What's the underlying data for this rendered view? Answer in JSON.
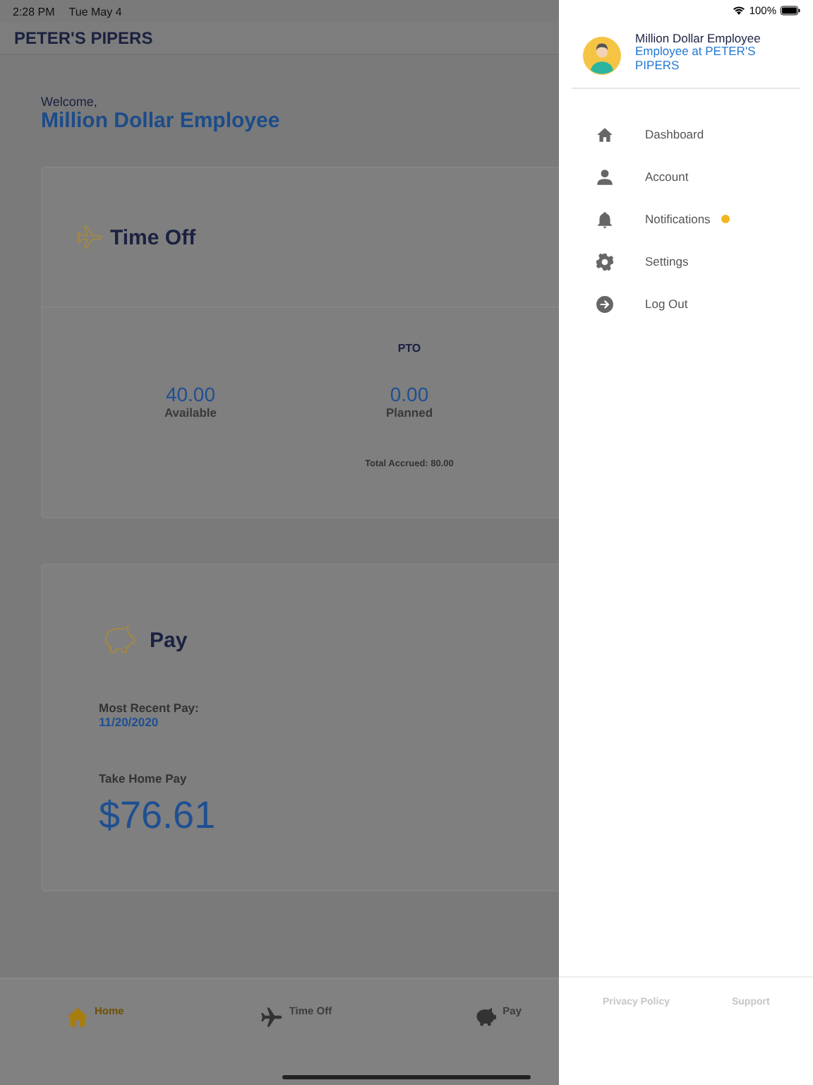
{
  "status_bar": {
    "time": "2:28 PM",
    "date": "Tue May 4",
    "battery": "100%"
  },
  "header": {
    "title": "PETER'S PIPERS"
  },
  "welcome": {
    "greeting": "Welcome,",
    "name": "Million Dollar Employee"
  },
  "time_off": {
    "title": "Time Off",
    "plan": "PTO",
    "stats": [
      {
        "value": "40.00",
        "label": "Available"
      },
      {
        "value": "0.00",
        "label": "Planned"
      }
    ],
    "total": "Total Accrued: 80.00"
  },
  "pay": {
    "title": "Pay",
    "recent_label": "Most Recent Pay:",
    "recent_date": "11/20/2020",
    "take_home_label": "Take Home Pay",
    "take_home": "$76.61"
  },
  "bottom_nav": [
    {
      "label": "Home",
      "kind": "home",
      "selected": true
    },
    {
      "label": "Time Off",
      "kind": "plane",
      "selected": false
    },
    {
      "label": "Pay",
      "kind": "piggy",
      "selected": false
    }
  ],
  "drawer": {
    "user": {
      "name": "Million Dollar Employee",
      "role": "Employee at PETER'S PIPERS"
    },
    "items": [
      {
        "label": "Dashboard",
        "kind": "home",
        "badge": false
      },
      {
        "label": "Account",
        "kind": "person",
        "badge": false
      },
      {
        "label": "Notifications",
        "kind": "bell",
        "badge": true
      },
      {
        "label": "Settings",
        "kind": "gear",
        "badge": false
      },
      {
        "label": "Log Out",
        "kind": "logout",
        "badge": false
      }
    ],
    "footer": [
      "Privacy Policy",
      "Support"
    ]
  }
}
